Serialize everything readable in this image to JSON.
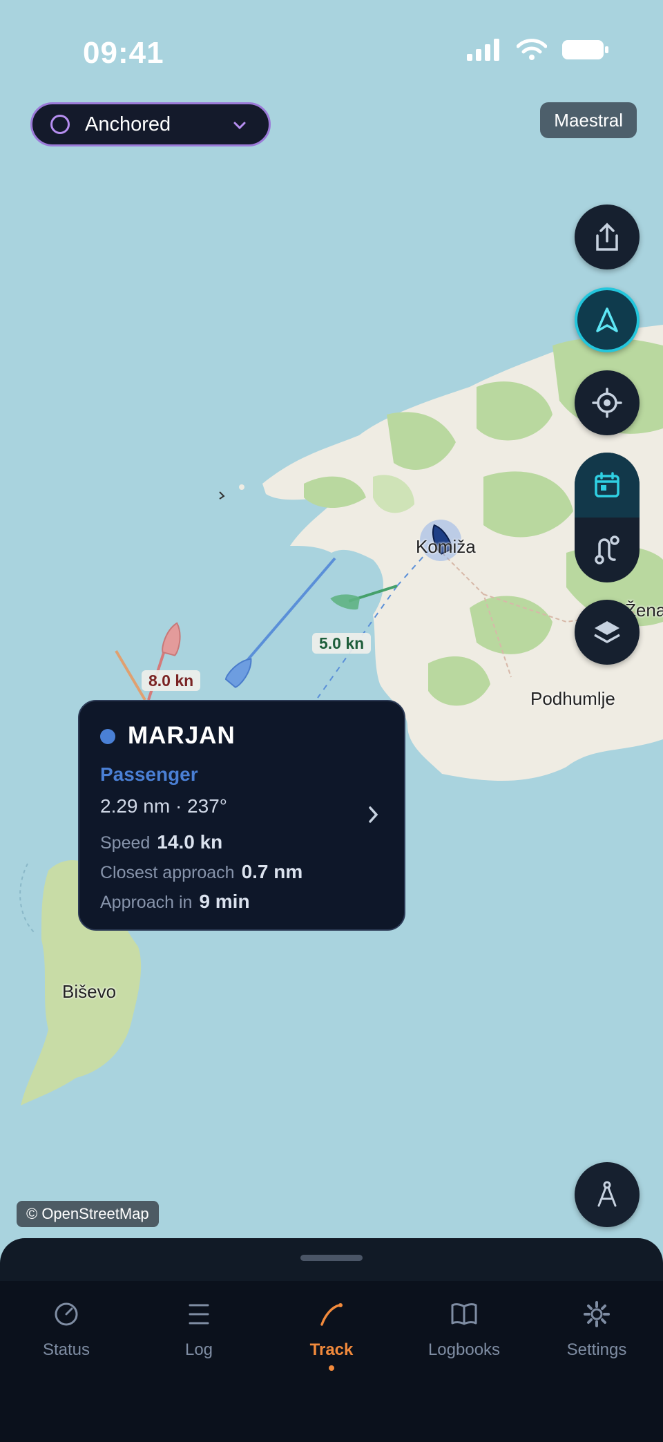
{
  "status_bar": {
    "time": "09:41"
  },
  "anchor_selector": {
    "label": "Anchored"
  },
  "wind_badge": {
    "label": "Maestral"
  },
  "map": {
    "places": {
      "komiza": "Komiža",
      "zena": "Žena",
      "podhumlje": "Podhumlje",
      "bisevo": "Biševo"
    },
    "speeds": {
      "red_vessel": "8.0 kn",
      "green_vessel": "5.0 kn"
    },
    "attribution": "© OpenStreetMap",
    "colors": {
      "sea": "#a9d3de",
      "land": "#efece3",
      "vegetation": "#b9d89f"
    }
  },
  "vessel_card": {
    "name": "MARJAN",
    "type": "Passenger",
    "distance_bearing": "2.29 nm · 237°",
    "speed_label": "Speed",
    "speed_value": "14.0 kn",
    "cpa_label": "Closest approach",
    "cpa_value": "0.7 nm",
    "tcpa_label": "Approach in",
    "tcpa_value": "9 min",
    "accent": "#4a80d6"
  },
  "tabs": [
    {
      "label": "Status",
      "icon": "gauge-icon"
    },
    {
      "label": "Log",
      "icon": "list-icon"
    },
    {
      "label": "Track",
      "icon": "track-icon",
      "active": true
    },
    {
      "label": "Logbooks",
      "icon": "book-icon"
    },
    {
      "label": "Settings",
      "icon": "gear-icon"
    }
  ],
  "accent_colors": {
    "active_tab": "#f28a3c",
    "nav_active": "#23c6dc",
    "anchor_ring": "#b68ef0"
  }
}
